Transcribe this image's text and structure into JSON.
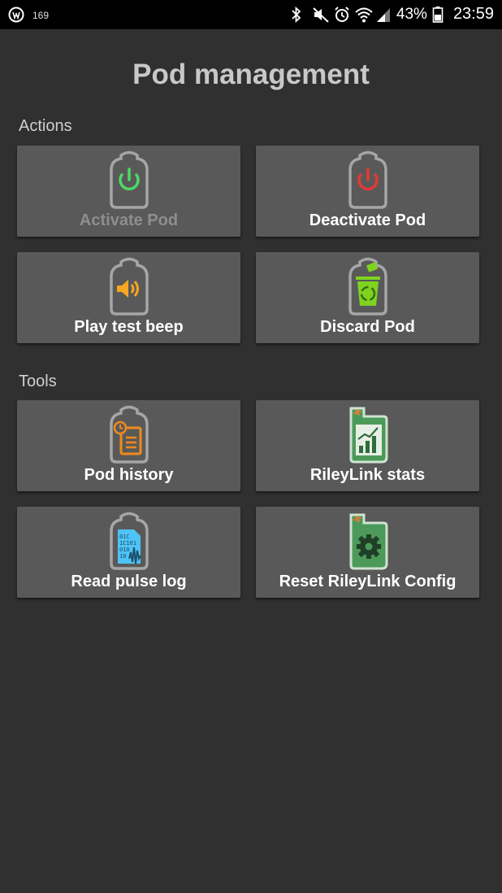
{
  "status_bar": {
    "notification_count": "169",
    "battery_percent": "43%",
    "time": "23:59",
    "icons": [
      "bluetooth-icon",
      "mute-vibrate-icon",
      "alarm-icon",
      "wifi-icon",
      "signal-icon",
      "battery-icon"
    ]
  },
  "page": {
    "title": "Pod management"
  },
  "sections": {
    "actions_label": "Actions",
    "tools_label": "Tools"
  },
  "actions": {
    "activate": {
      "label": "Activate Pod",
      "icon": "power-green-icon",
      "enabled": false
    },
    "deactivate": {
      "label": "Deactivate Pod",
      "icon": "power-red-icon",
      "enabled": true
    },
    "test_beep": {
      "label": "Play test beep",
      "icon": "speaker-icon",
      "enabled": true
    },
    "discard": {
      "label": "Discard Pod",
      "icon": "recycle-bin-icon",
      "enabled": true
    }
  },
  "tools": {
    "pod_history": {
      "label": "Pod history",
      "icon": "history-clipboard-icon"
    },
    "rileylink_stats": {
      "label": "RileyLink stats",
      "icon": "stats-chart-icon"
    },
    "pulse_log": {
      "label": "Read pulse log",
      "icon": "binary-waveform-icon"
    },
    "reset_config": {
      "label": "Reset RileyLink Config",
      "icon": "gear-reset-icon"
    }
  },
  "colors": {
    "background": "#303030",
    "tile": "#595959",
    "power_green": "#4cd964",
    "power_red": "#e53935",
    "speaker_orange": "#f5a623",
    "recycle_green": "#7ed321",
    "history_orange": "#f08a1c",
    "riley_green": "#4c9a5a",
    "pulse_cyan": "#4fc3f7"
  }
}
